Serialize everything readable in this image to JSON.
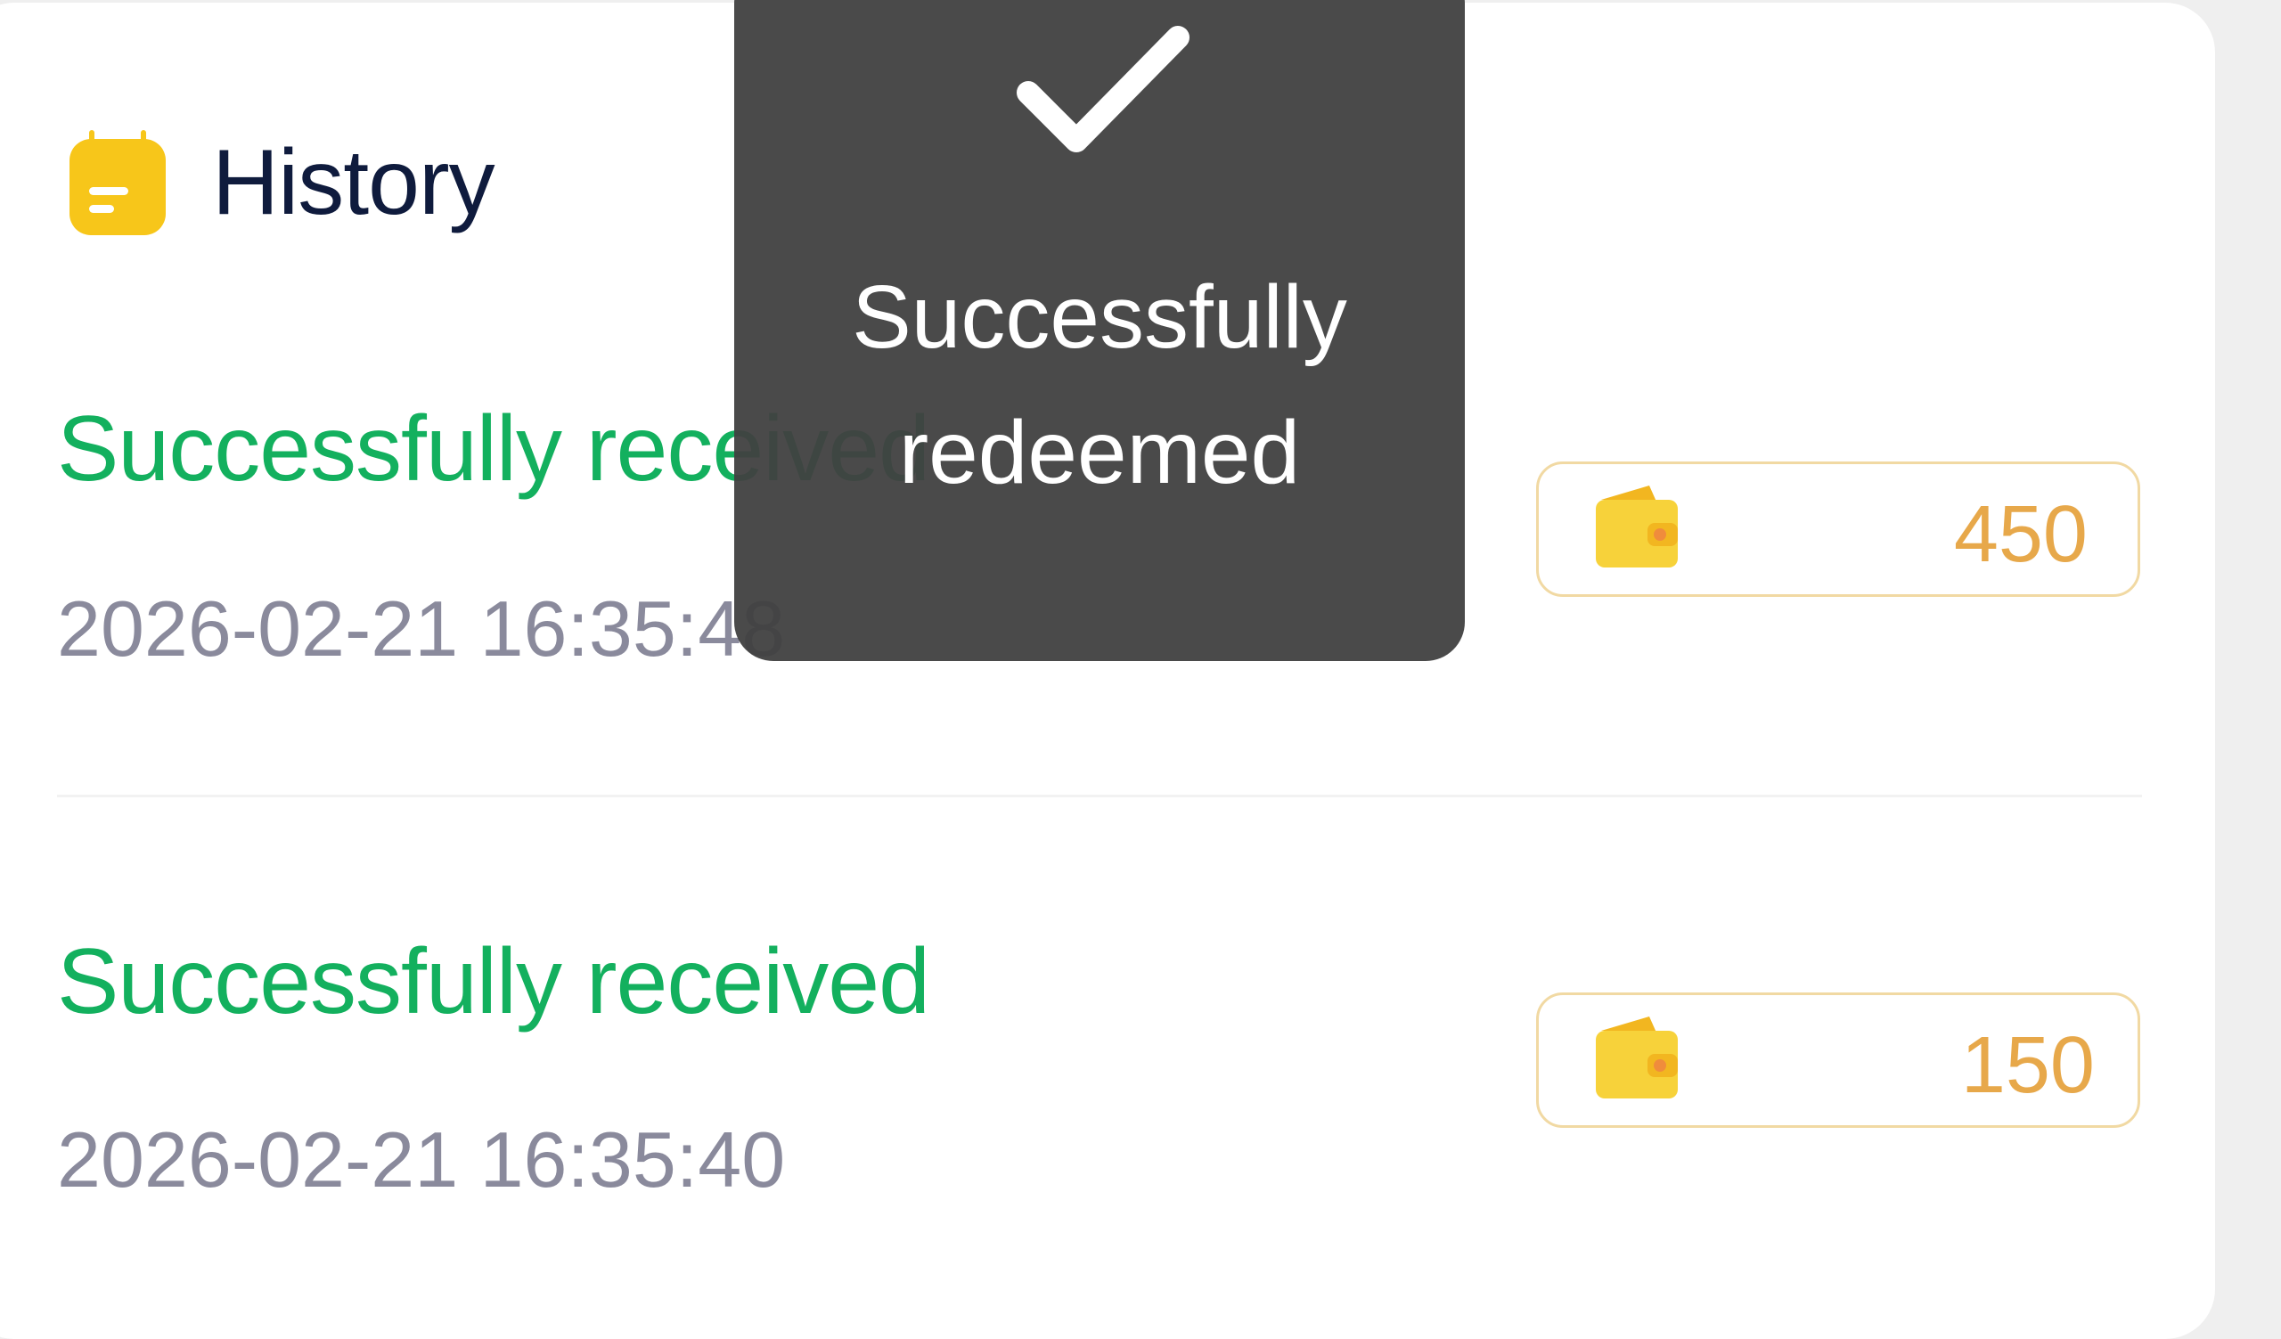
{
  "history": {
    "title": "History"
  },
  "records": [
    {
      "status": "Successfully received",
      "time": "2026-02-21 16:35:48",
      "amount": "450"
    },
    {
      "status": "Successfully received",
      "time": "2026-02-21 16:35:40",
      "amount": "150"
    }
  ],
  "toast": {
    "message_line1": "Successfully",
    "message_line2": "redeemed"
  },
  "colors": {
    "status_green": "#13b05e",
    "amount_gold": "#e7a84a",
    "icon_yellow": "#f7c61a",
    "toast_bg": "#404040"
  },
  "icons": {
    "history": "notepad-icon",
    "wallet": "wallet-icon",
    "toast": "checkmark-icon"
  }
}
